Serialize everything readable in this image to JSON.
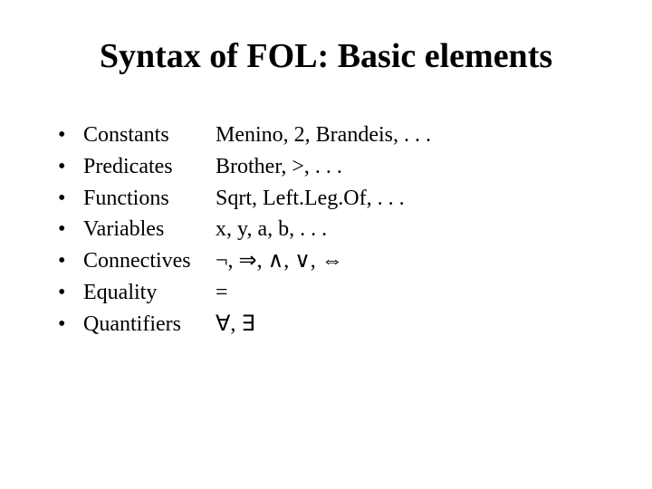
{
  "title": "Syntax of FOL: Basic elements",
  "items": [
    {
      "term": "Constants",
      "example": "Menino, 2, Brandeis, . . ."
    },
    {
      "term": "Predicates",
      "example": "Brother, >, . . ."
    },
    {
      "term": "Functions",
      "example": "Sqrt, Left.Leg.Of, . . ."
    },
    {
      "term": "Variables",
      "example": "x, y, a, b, . . ."
    },
    {
      "term": "Connectives",
      "example": "¬, ⇒, ∧, ∨, ⇔"
    },
    {
      "term": "Equality",
      "example": "="
    },
    {
      "term": "Quantifiers",
      "example": "∀, ∃"
    }
  ]
}
